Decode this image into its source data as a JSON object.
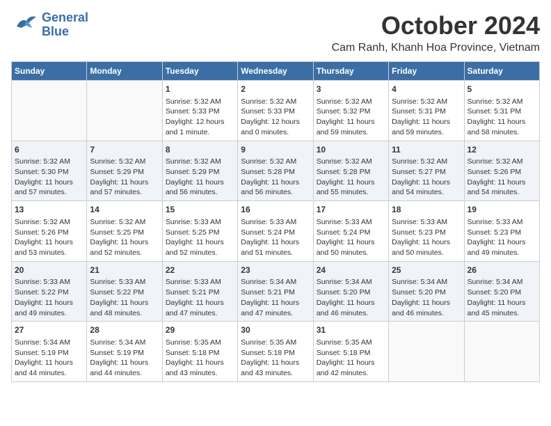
{
  "logo": {
    "line1": "General",
    "line2": "Blue"
  },
  "title": "October 2024",
  "location": "Cam Ranh, Khanh Hoa Province, Vietnam",
  "weekdays": [
    "Sunday",
    "Monday",
    "Tuesday",
    "Wednesday",
    "Thursday",
    "Friday",
    "Saturday"
  ],
  "weeks": [
    [
      {
        "day": "",
        "info": ""
      },
      {
        "day": "",
        "info": ""
      },
      {
        "day": "1",
        "info": "Sunrise: 5:32 AM\nSunset: 5:33 PM\nDaylight: 12 hours\nand 1 minute."
      },
      {
        "day": "2",
        "info": "Sunrise: 5:32 AM\nSunset: 5:33 PM\nDaylight: 12 hours\nand 0 minutes."
      },
      {
        "day": "3",
        "info": "Sunrise: 5:32 AM\nSunset: 5:32 PM\nDaylight: 11 hours\nand 59 minutes."
      },
      {
        "day": "4",
        "info": "Sunrise: 5:32 AM\nSunset: 5:31 PM\nDaylight: 11 hours\nand 59 minutes."
      },
      {
        "day": "5",
        "info": "Sunrise: 5:32 AM\nSunset: 5:31 PM\nDaylight: 11 hours\nand 58 minutes."
      }
    ],
    [
      {
        "day": "6",
        "info": "Sunrise: 5:32 AM\nSunset: 5:30 PM\nDaylight: 11 hours\nand 57 minutes."
      },
      {
        "day": "7",
        "info": "Sunrise: 5:32 AM\nSunset: 5:29 PM\nDaylight: 11 hours\nand 57 minutes."
      },
      {
        "day": "8",
        "info": "Sunrise: 5:32 AM\nSunset: 5:29 PM\nDaylight: 11 hours\nand 56 minutes."
      },
      {
        "day": "9",
        "info": "Sunrise: 5:32 AM\nSunset: 5:28 PM\nDaylight: 11 hours\nand 56 minutes."
      },
      {
        "day": "10",
        "info": "Sunrise: 5:32 AM\nSunset: 5:28 PM\nDaylight: 11 hours\nand 55 minutes."
      },
      {
        "day": "11",
        "info": "Sunrise: 5:32 AM\nSunset: 5:27 PM\nDaylight: 11 hours\nand 54 minutes."
      },
      {
        "day": "12",
        "info": "Sunrise: 5:32 AM\nSunset: 5:26 PM\nDaylight: 11 hours\nand 54 minutes."
      }
    ],
    [
      {
        "day": "13",
        "info": "Sunrise: 5:32 AM\nSunset: 5:26 PM\nDaylight: 11 hours\nand 53 minutes."
      },
      {
        "day": "14",
        "info": "Sunrise: 5:32 AM\nSunset: 5:25 PM\nDaylight: 11 hours\nand 52 minutes."
      },
      {
        "day": "15",
        "info": "Sunrise: 5:33 AM\nSunset: 5:25 PM\nDaylight: 11 hours\nand 52 minutes."
      },
      {
        "day": "16",
        "info": "Sunrise: 5:33 AM\nSunset: 5:24 PM\nDaylight: 11 hours\nand 51 minutes."
      },
      {
        "day": "17",
        "info": "Sunrise: 5:33 AM\nSunset: 5:24 PM\nDaylight: 11 hours\nand 50 minutes."
      },
      {
        "day": "18",
        "info": "Sunrise: 5:33 AM\nSunset: 5:23 PM\nDaylight: 11 hours\nand 50 minutes."
      },
      {
        "day": "19",
        "info": "Sunrise: 5:33 AM\nSunset: 5:23 PM\nDaylight: 11 hours\nand 49 minutes."
      }
    ],
    [
      {
        "day": "20",
        "info": "Sunrise: 5:33 AM\nSunset: 5:22 PM\nDaylight: 11 hours\nand 49 minutes."
      },
      {
        "day": "21",
        "info": "Sunrise: 5:33 AM\nSunset: 5:22 PM\nDaylight: 11 hours\nand 48 minutes."
      },
      {
        "day": "22",
        "info": "Sunrise: 5:33 AM\nSunset: 5:21 PM\nDaylight: 11 hours\nand 47 minutes."
      },
      {
        "day": "23",
        "info": "Sunrise: 5:34 AM\nSunset: 5:21 PM\nDaylight: 11 hours\nand 47 minutes."
      },
      {
        "day": "24",
        "info": "Sunrise: 5:34 AM\nSunset: 5:20 PM\nDaylight: 11 hours\nand 46 minutes."
      },
      {
        "day": "25",
        "info": "Sunrise: 5:34 AM\nSunset: 5:20 PM\nDaylight: 11 hours\nand 46 minutes."
      },
      {
        "day": "26",
        "info": "Sunrise: 5:34 AM\nSunset: 5:20 PM\nDaylight: 11 hours\nand 45 minutes."
      }
    ],
    [
      {
        "day": "27",
        "info": "Sunrise: 5:34 AM\nSunset: 5:19 PM\nDaylight: 11 hours\nand 44 minutes."
      },
      {
        "day": "28",
        "info": "Sunrise: 5:34 AM\nSunset: 5:19 PM\nDaylight: 11 hours\nand 44 minutes."
      },
      {
        "day": "29",
        "info": "Sunrise: 5:35 AM\nSunset: 5:18 PM\nDaylight: 11 hours\nand 43 minutes."
      },
      {
        "day": "30",
        "info": "Sunrise: 5:35 AM\nSunset: 5:18 PM\nDaylight: 11 hours\nand 43 minutes."
      },
      {
        "day": "31",
        "info": "Sunrise: 5:35 AM\nSunset: 5:18 PM\nDaylight: 11 hours\nand 42 minutes."
      },
      {
        "day": "",
        "info": ""
      },
      {
        "day": "",
        "info": ""
      }
    ]
  ]
}
